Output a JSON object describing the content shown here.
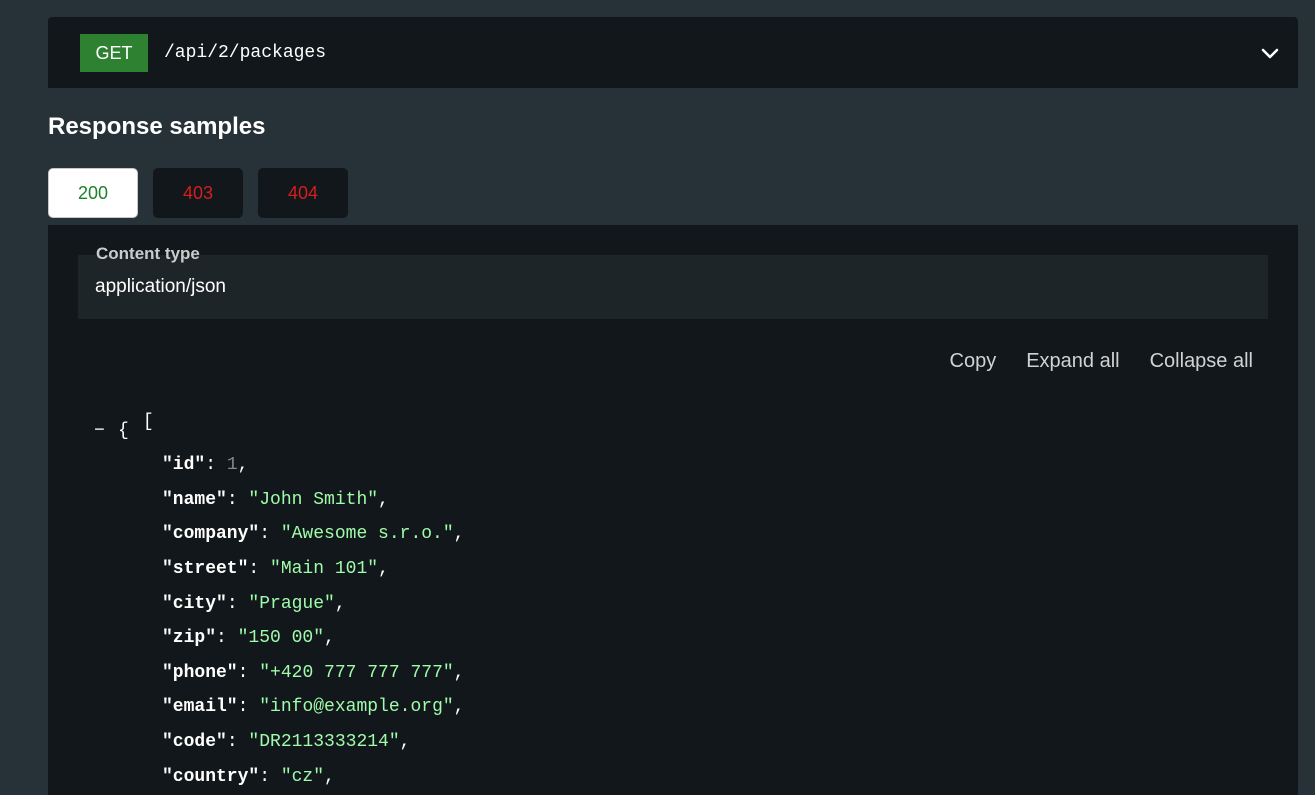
{
  "endpoint": {
    "method": "GET",
    "path": "/api/2/packages",
    "toggle_icon": "chevron-down-icon"
  },
  "response_samples": {
    "title": "Response samples",
    "tabs": [
      {
        "label": "200",
        "active": true,
        "color": "#1d8127"
      },
      {
        "label": "403",
        "active": false,
        "color": "#d41f1c"
      },
      {
        "label": "404",
        "active": false,
        "color": "#d41f1c"
      }
    ],
    "content_type_label": "Content type",
    "content_type_value": "application/json",
    "actions": {
      "copy": "Copy",
      "expand_all": "Expand all",
      "collapse_all": "Collapse all"
    }
  },
  "code": {
    "open_bracket": "[",
    "collapser": "−",
    "open_brace": "{",
    "properties": [
      {
        "key": "\"id\"",
        "value": "1",
        "type": "number"
      },
      {
        "key": "\"name\"",
        "value": "\"John Smith\"",
        "type": "string"
      },
      {
        "key": "\"company\"",
        "value": "\"Awesome s.r.o.\"",
        "type": "string"
      },
      {
        "key": "\"street\"",
        "value": "\"Main 101\"",
        "type": "string"
      },
      {
        "key": "\"city\"",
        "value": "\"Prague\"",
        "type": "string"
      },
      {
        "key": "\"zip\"",
        "value": "\"150 00\"",
        "type": "string"
      },
      {
        "key": "\"phone\"",
        "value": "\"+420 777 777 777\"",
        "type": "string"
      },
      {
        "key": "\"email\"",
        "value": "\"info@example.org\"",
        "type": "string"
      },
      {
        "key": "\"code\"",
        "value": "\"DR2113333214\"",
        "type": "string"
      },
      {
        "key": "\"country\"",
        "value": "\"cz\"",
        "type": "string"
      }
    ]
  },
  "colors": {
    "page_bg": "#263238",
    "panel_bg": "#11171a",
    "method_get": "#2f8132",
    "string_value": "#a0fbaa",
    "number_value": "#888888"
  }
}
